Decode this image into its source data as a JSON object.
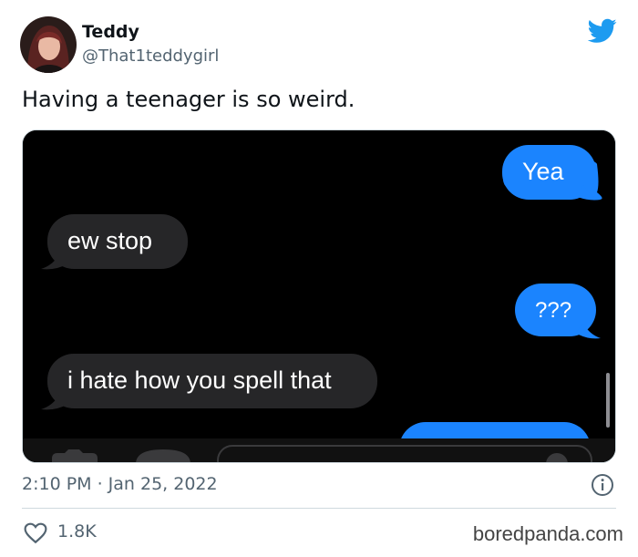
{
  "author": {
    "display_name": "Teddy",
    "handle": "@That1teddygirl"
  },
  "tweet": {
    "text": "Having a teenager is so weird."
  },
  "screenshot": {
    "messages": [
      {
        "sender": "me",
        "text": "Yea"
      },
      {
        "sender": "them",
        "text": "ew stop"
      },
      {
        "sender": "me",
        "text": "???"
      },
      {
        "sender": "them",
        "text": "i hate how you spell that"
      }
    ],
    "colors": {
      "sent_bubble": "#1b84fe",
      "received_bubble": "#262628",
      "background": "#000000"
    }
  },
  "meta": {
    "timestamp": "2:10 PM · Jan 25, 2022"
  },
  "engagement": {
    "likes": "1.8K"
  },
  "icons": [
    "twitter-bird-icon",
    "info-icon",
    "heart-icon"
  ],
  "watermark": "boredpanda.com",
  "colors": {
    "brand": "#1d9bf0",
    "muted_text": "#536471"
  }
}
